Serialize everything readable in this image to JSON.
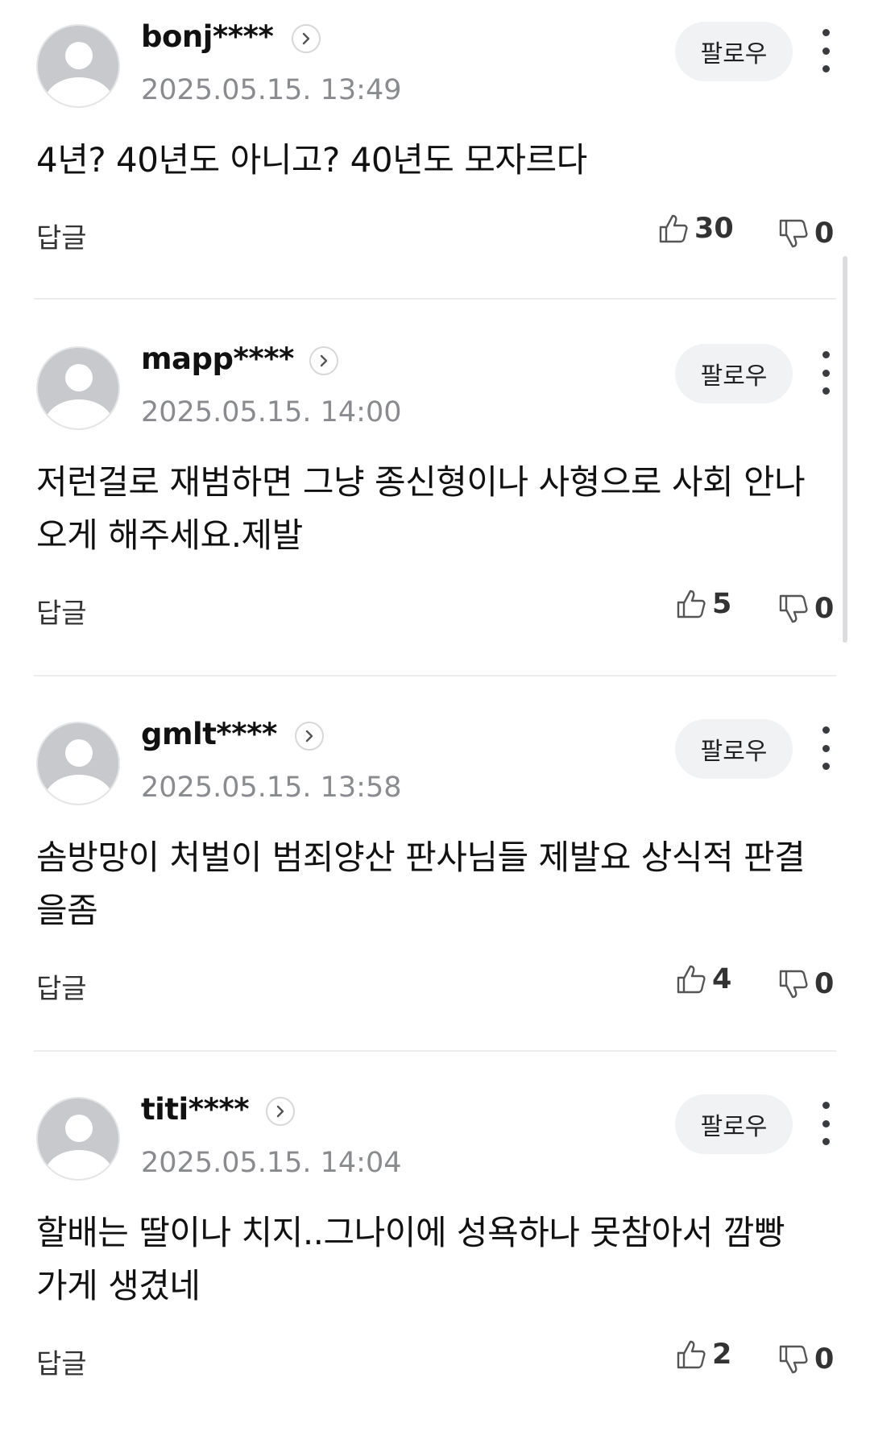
{
  "follow_label": "팔로우",
  "reply_label": "답글",
  "comments": [
    {
      "username": "bonj****",
      "timestamp": "2025.05.15. 13:49",
      "text": "4년? 40년도 아니고? 40년도 모자르다",
      "likes": "30",
      "dislikes": "0"
    },
    {
      "username": "mapp****",
      "timestamp": "2025.05.15. 14:00",
      "text": "저런걸로 재범하면 그냥 종신형이나 사형으로 사회 안나오게 해주세요.제발",
      "likes": "5",
      "dislikes": "0"
    },
    {
      "username": "gmlt****",
      "timestamp": "2025.05.15. 13:58",
      "text": "솜방망이 처벌이 범죄양산 판사님들 제발요 상식적 판결을좀",
      "likes": "4",
      "dislikes": "0"
    },
    {
      "username": "titi****",
      "timestamp": "2025.05.15. 14:04",
      "text": "할배는 딸이나 치지..그나이에 성욕하나 못참아서 깜빵가게 생겼네",
      "likes": "2",
      "dislikes": "0"
    }
  ],
  "icons": {
    "avatar": "default-user-avatar",
    "profile_arrow": "chevron-right-circle-icon",
    "more": "vertical-ellipsis-icon",
    "like": "thumbs-up-icon",
    "dislike": "thumbs-down-icon"
  },
  "colors": {
    "timestamp": "#8a8b8f",
    "follow_bg": "#f1f2f4",
    "divider": "#ececee",
    "avatar": "#c8c9cc"
  }
}
